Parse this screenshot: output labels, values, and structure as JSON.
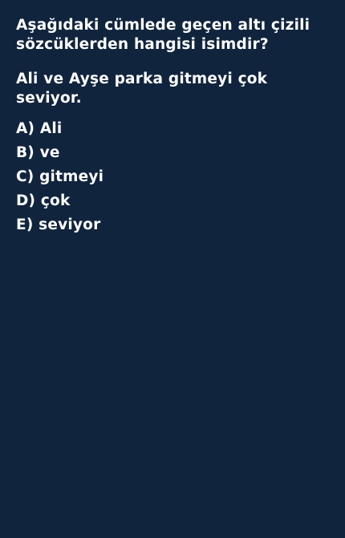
{
  "question": "Aşağıdaki cümlede geçen altı çizili sözcüklerden hangisi isimdir?",
  "sentence": "Ali ve Ayşe parka gitmeyi çok seviyor.",
  "options": [
    {
      "letter": "A)",
      "text": "Ali"
    },
    {
      "letter": "B)",
      "text": "ve"
    },
    {
      "letter": "C)",
      "text": "gitmeyi"
    },
    {
      "letter": "D)",
      "text": "çok"
    },
    {
      "letter": "E)",
      "text": "seviyor"
    }
  ],
  "colors": {
    "background": "#10243e",
    "text": "#ffffff"
  }
}
